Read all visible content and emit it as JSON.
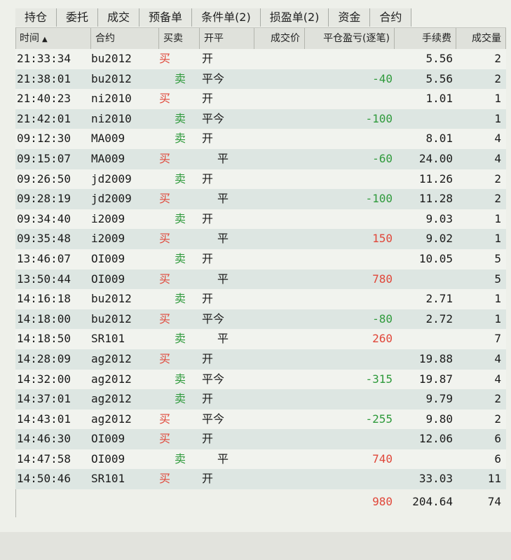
{
  "tabs": [
    {
      "label": "持仓",
      "active": true
    },
    {
      "label": "委托",
      "active": false
    },
    {
      "label": "成交",
      "active": false
    },
    {
      "label": "预备单",
      "active": false
    },
    {
      "label": "条件单(2)",
      "active": false
    },
    {
      "label": "损盈单(2)",
      "active": false
    },
    {
      "label": "资金",
      "active": false
    },
    {
      "label": "合约",
      "active": false
    }
  ],
  "header": {
    "time": "时间",
    "sort_icon": "▲",
    "contract": "合约",
    "buy_sell": "买卖",
    "open_close": "开平",
    "price": "成交价",
    "pnl": "平仓盈亏(逐笔)",
    "fee": "手续费",
    "volume": "成交量"
  },
  "rows": [
    {
      "time": "21:33:34",
      "contract": "bu2012",
      "bs": "买",
      "side": "buy",
      "oc": "开",
      "pnl": "",
      "pnl_sign": "",
      "fee": "5.56",
      "vol": "2"
    },
    {
      "time": "21:38:01",
      "contract": "bu2012",
      "bs": "卖",
      "side": "sell",
      "oc": "平今",
      "pnl": "-40",
      "pnl_sign": "neg",
      "fee": "5.56",
      "vol": "2"
    },
    {
      "time": "21:40:23",
      "contract": "ni2010",
      "bs": "买",
      "side": "buy",
      "oc": "开",
      "pnl": "",
      "pnl_sign": "",
      "fee": "1.01",
      "vol": "1"
    },
    {
      "time": "21:42:01",
      "contract": "ni2010",
      "bs": "卖",
      "side": "sell",
      "oc": "平今",
      "pnl": "-100",
      "pnl_sign": "neg",
      "fee": "",
      "vol": "1"
    },
    {
      "time": "09:12:30",
      "contract": "MA009",
      "bs": "卖",
      "side": "sell",
      "oc": "开",
      "pnl": "",
      "pnl_sign": "",
      "fee": "8.01",
      "vol": "4"
    },
    {
      "time": "09:15:07",
      "contract": "MA009",
      "bs": "买",
      "side": "buy",
      "oc": "平",
      "pnl": "-60",
      "pnl_sign": "neg",
      "fee": "24.00",
      "vol": "4"
    },
    {
      "time": "09:26:50",
      "contract": "jd2009",
      "bs": "卖",
      "side": "sell",
      "oc": "开",
      "pnl": "",
      "pnl_sign": "",
      "fee": "11.26",
      "vol": "2"
    },
    {
      "time": "09:28:19",
      "contract": "jd2009",
      "bs": "买",
      "side": "buy",
      "oc": "平",
      "pnl": "-100",
      "pnl_sign": "neg",
      "fee": "11.28",
      "vol": "2"
    },
    {
      "time": "09:34:40",
      "contract": "i2009",
      "bs": "卖",
      "side": "sell",
      "oc": "开",
      "pnl": "",
      "pnl_sign": "",
      "fee": "9.03",
      "vol": "1"
    },
    {
      "time": "09:35:48",
      "contract": "i2009",
      "bs": "买",
      "side": "buy",
      "oc": "平",
      "pnl": "150",
      "pnl_sign": "pos",
      "fee": "9.02",
      "vol": "1"
    },
    {
      "time": "13:46:07",
      "contract": "OI009",
      "bs": "卖",
      "side": "sell",
      "oc": "开",
      "pnl": "",
      "pnl_sign": "",
      "fee": "10.05",
      "vol": "5"
    },
    {
      "time": "13:50:44",
      "contract": "OI009",
      "bs": "买",
      "side": "buy",
      "oc": "平",
      "pnl": "780",
      "pnl_sign": "pos",
      "fee": "",
      "vol": "5"
    },
    {
      "time": "14:16:18",
      "contract": "bu2012",
      "bs": "卖",
      "side": "sell",
      "oc": "开",
      "pnl": "",
      "pnl_sign": "",
      "fee": "2.71",
      "vol": "1"
    },
    {
      "time": "14:18:00",
      "contract": "bu2012",
      "bs": "买",
      "side": "buy",
      "oc": "平今",
      "pnl": "-80",
      "pnl_sign": "neg",
      "fee": "2.72",
      "vol": "1"
    },
    {
      "time": "14:18:50",
      "contract": "SR101",
      "bs": "卖",
      "side": "sell",
      "oc": "平",
      "pnl": "260",
      "pnl_sign": "pos",
      "fee": "",
      "vol": "7"
    },
    {
      "time": "14:28:09",
      "contract": "ag2012",
      "bs": "买",
      "side": "buy",
      "oc": "开",
      "pnl": "",
      "pnl_sign": "",
      "fee": "19.88",
      "vol": "4"
    },
    {
      "time": "14:32:00",
      "contract": "ag2012",
      "bs": "卖",
      "side": "sell",
      "oc": "平今",
      "pnl": "-315",
      "pnl_sign": "neg",
      "fee": "19.87",
      "vol": "4"
    },
    {
      "time": "14:37:01",
      "contract": "ag2012",
      "bs": "卖",
      "side": "sell",
      "oc": "开",
      "pnl": "",
      "pnl_sign": "",
      "fee": "9.79",
      "vol": "2"
    },
    {
      "time": "14:43:01",
      "contract": "ag2012",
      "bs": "买",
      "side": "buy",
      "oc": "平今",
      "pnl": "-255",
      "pnl_sign": "neg",
      "fee": "9.80",
      "vol": "2"
    },
    {
      "time": "14:46:30",
      "contract": "OI009",
      "bs": "买",
      "side": "buy",
      "oc": "开",
      "pnl": "",
      "pnl_sign": "",
      "fee": "12.06",
      "vol": "6"
    },
    {
      "time": "14:47:58",
      "contract": "OI009",
      "bs": "卖",
      "side": "sell",
      "oc": "平",
      "pnl": "740",
      "pnl_sign": "pos",
      "fee": "",
      "vol": "6"
    },
    {
      "time": "14:50:46",
      "contract": "SR101",
      "bs": "买",
      "side": "buy",
      "oc": "开",
      "pnl": "",
      "pnl_sign": "",
      "fee": "33.03",
      "vol": "11"
    }
  ],
  "total": {
    "pnl": "980",
    "fee": "204.64",
    "vol": "74"
  },
  "colors": {
    "buy": "#e0473a",
    "sell": "#2f9a3c",
    "row_alt": "#dde6e2"
  }
}
